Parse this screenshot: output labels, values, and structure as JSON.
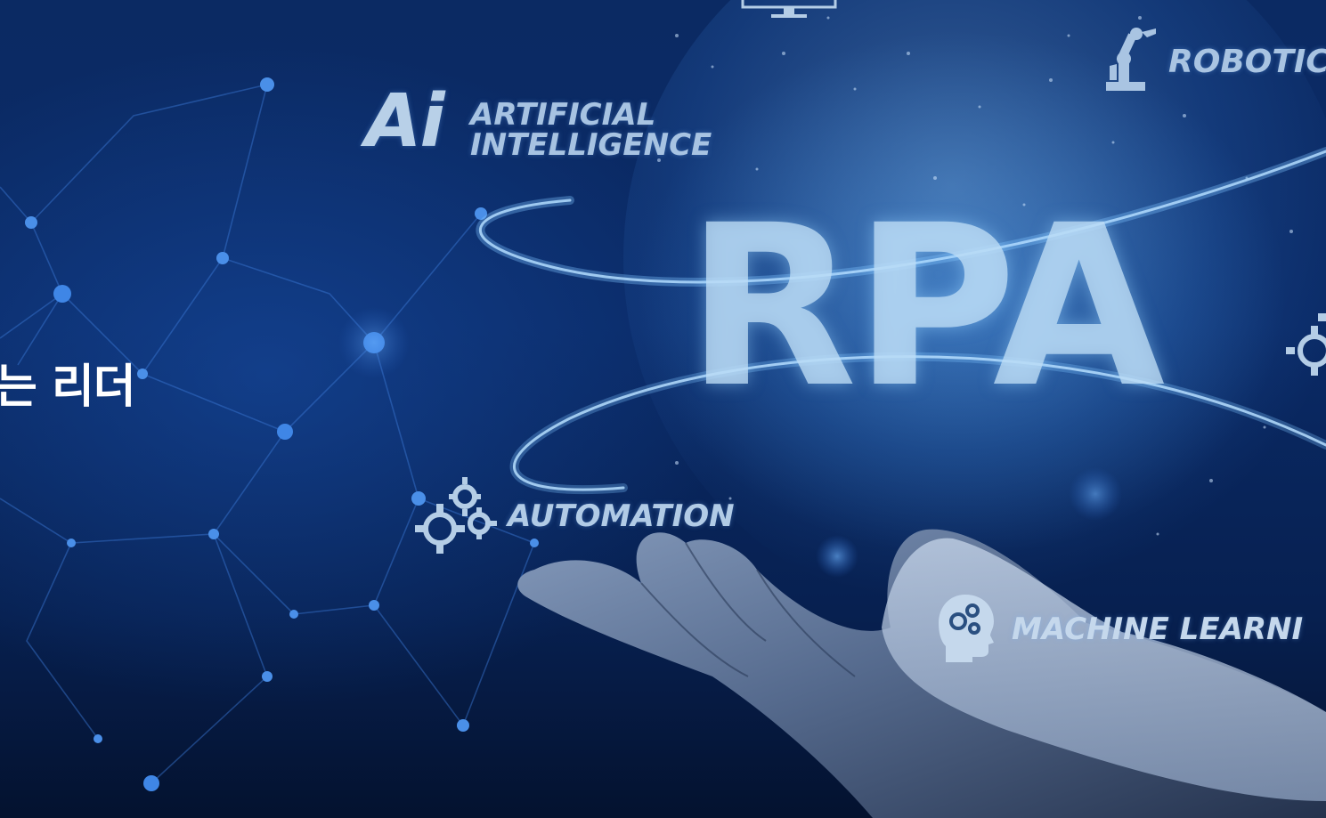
{
  "hero": {
    "heading_fragment": "는 리더"
  },
  "graphic": {
    "ai_mark": "Ai",
    "ai_text_line1": "ARTIFICIAL",
    "ai_text_line2": "INTELLIGENCE",
    "center_text": "RPA",
    "automation_text": "AUTOMATION",
    "robotics_text": "ROBOTIC",
    "machine_learning_text": "MACHINE LEARNI"
  },
  "icons": {
    "ai": "ai-logo-icon",
    "gears": "gears-icon",
    "robot_arm": "robot-arm-icon",
    "head_gears": "head-gears-icon",
    "monitor": "monitor-icon"
  },
  "colors": {
    "background_dark": "#04122f",
    "background_blue": "#0b2a63",
    "label_text": "#b4cde6",
    "heading_text": "#ffffff",
    "glow": "#8fd0ff"
  }
}
